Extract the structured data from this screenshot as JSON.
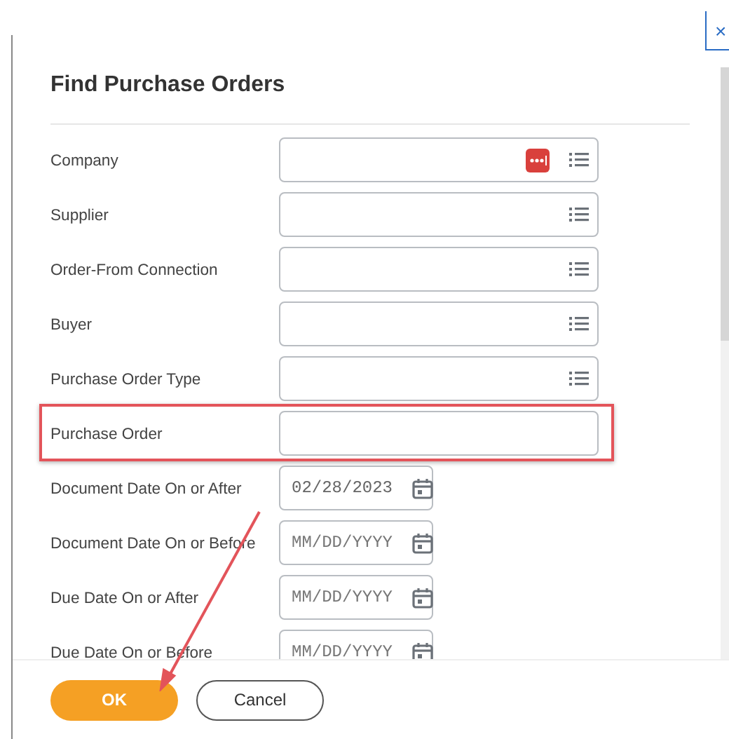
{
  "dialog": {
    "title": "Find Purchase Orders",
    "close_label": "×"
  },
  "fields": [
    {
      "label": "Company",
      "kind": "lookup",
      "extension_icon": true,
      "highlighted": false
    },
    {
      "label": "Supplier",
      "kind": "lookup",
      "extension_icon": false,
      "highlighted": false
    },
    {
      "label": "Order-From Connection",
      "kind": "lookup",
      "extension_icon": false,
      "highlighted": false
    },
    {
      "label": "Buyer",
      "kind": "lookup",
      "extension_icon": false,
      "highlighted": false
    },
    {
      "label": "Purchase Order Type",
      "kind": "lookup",
      "extension_icon": false,
      "highlighted": false
    },
    {
      "label": "Purchase Order",
      "kind": "text",
      "extension_icon": false,
      "highlighted": true
    },
    {
      "label": "Document Date On or After",
      "kind": "date",
      "value": "02/28/2023",
      "highlighted": false
    },
    {
      "label": "Document Date On or Before",
      "kind": "date",
      "placeholder": "MM/DD/YYYY",
      "highlighted": false
    },
    {
      "label": "Due Date On or After",
      "kind": "date",
      "placeholder": "MM/DD/YYYY",
      "highlighted": false
    },
    {
      "label": "Due Date On or Before",
      "kind": "date",
      "placeholder": "MM/DD/YYYY",
      "highlighted": false
    }
  ],
  "buttons": [
    {
      "label": "OK",
      "primary": true
    },
    {
      "label": "Cancel",
      "primary": false
    }
  ],
  "annotation_arrow": true
}
